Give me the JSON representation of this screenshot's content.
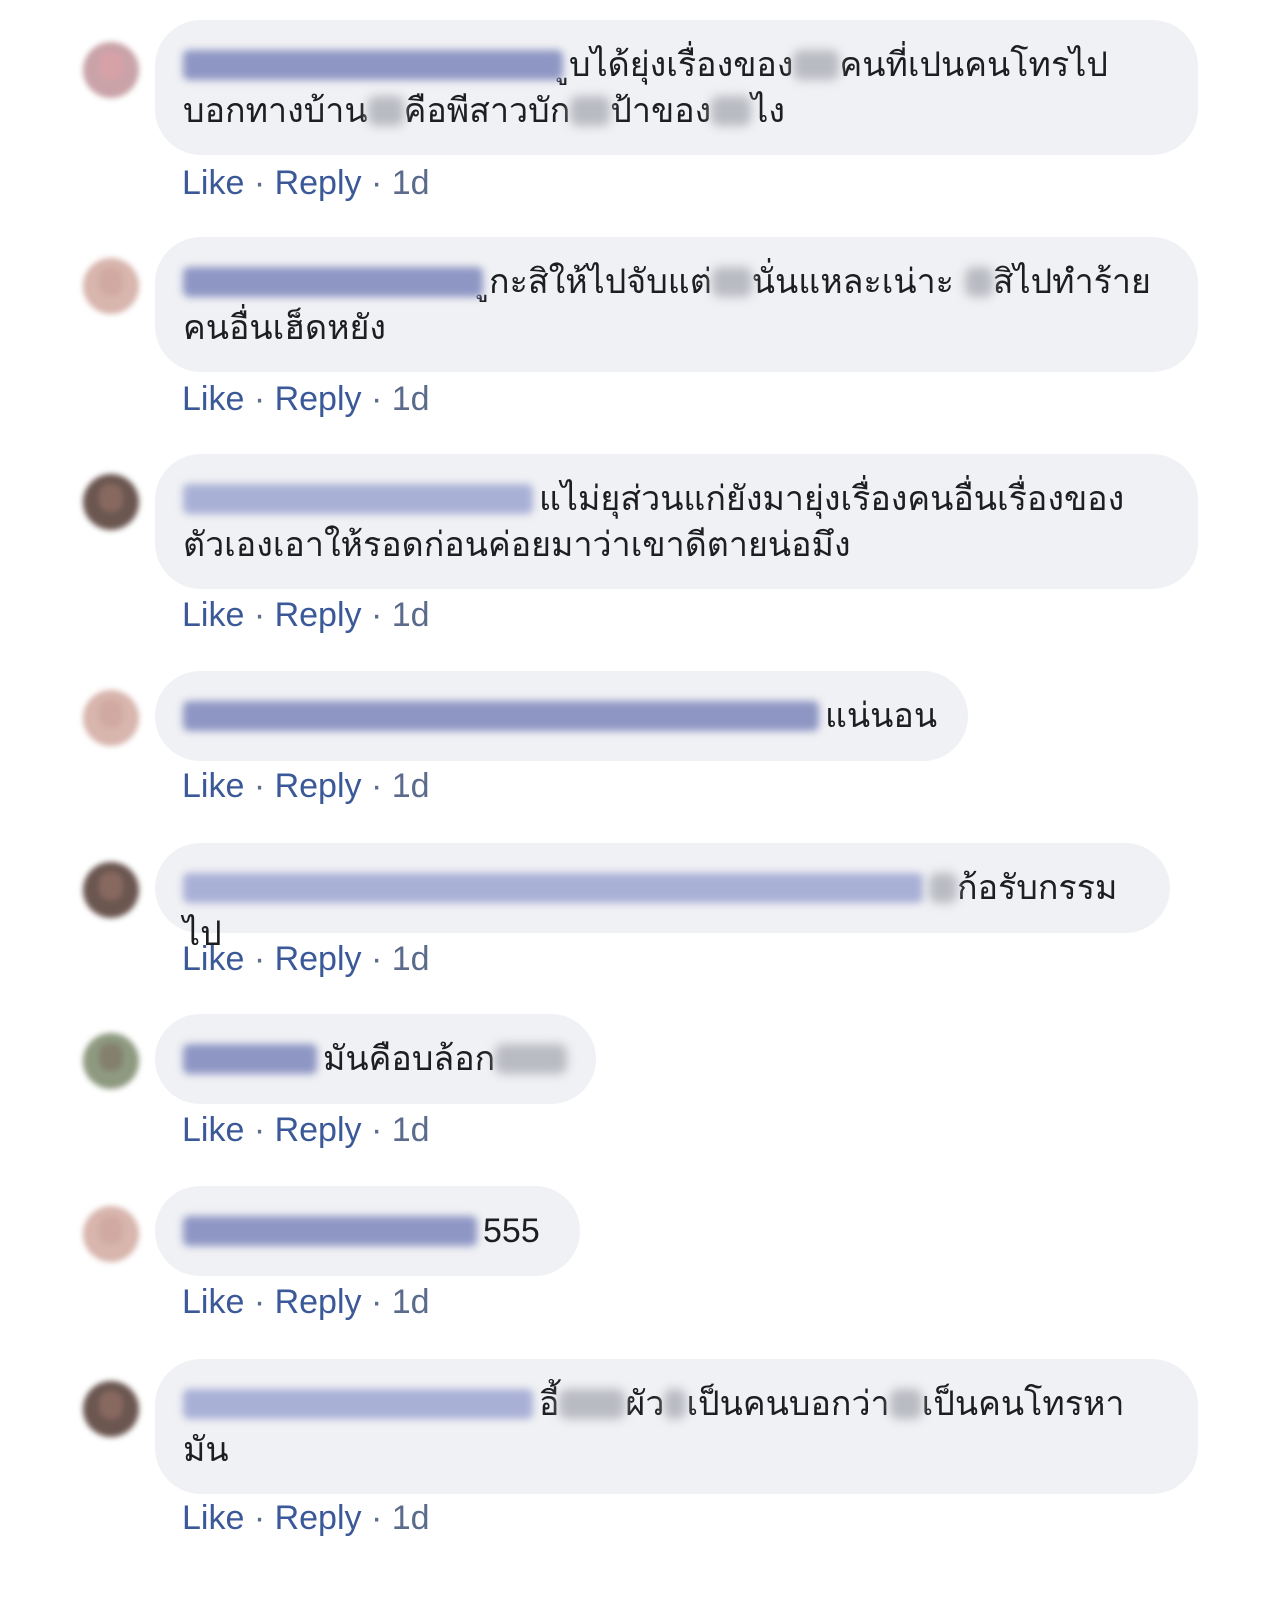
{
  "actions": {
    "like": "Like",
    "reply": "Reply",
    "separator": " · "
  },
  "comments": [
    {
      "text_a": "ูบได้ยุ่งเรื่องของ",
      "text_b": "คนที่เปนคนโทรไป",
      "text_c": "บอกทางบ้าน",
      "text_d": "คือพีสาวบัก",
      "text_e": "ป้าของ",
      "text_f": "ไง",
      "time": "1d"
    },
    {
      "text_a": "ูกะสิให้ไปจับแต่",
      "text_b": "นั่นแหละเน่าะ",
      "text_c": "สิไปทำร้าย",
      "text_d": "คนอื่นเฮ็ดหยัง",
      "time": "1d"
    },
    {
      "text_a": "แไม่ยุส่วนแก่ยังมายุ่งเรื่องคนอื่นเรื่องของ",
      "text_b": "ตัวเองเอาให้รอดก่อนค่อยมาว่าเขาดีตายน่อมึง",
      "time": "1d"
    },
    {
      "text_a": "แน่นอน",
      "time": "1d"
    },
    {
      "text_a": "ก้อรับกรรมไป",
      "time": "1d"
    },
    {
      "text_a": "มันคือบล้อก",
      "time": "1d"
    },
    {
      "text_a": "555",
      "time": "1d"
    },
    {
      "text_a": "อี้",
      "text_b": "ผัว",
      "text_c": "เป็นคนบอกว่า",
      "text_d": "เป็นคนโทรหา",
      "text_e": "มัน",
      "time": "1d"
    }
  ]
}
